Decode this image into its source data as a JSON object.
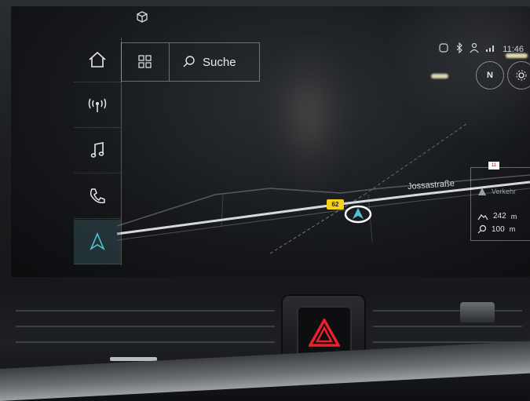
{
  "rail": {
    "items": [
      {
        "name": "home",
        "icon": "home-icon"
      },
      {
        "name": "radio",
        "icon": "radio-icon"
      },
      {
        "name": "media",
        "icon": "music-note-icon"
      },
      {
        "name": "phone",
        "icon": "phone-icon"
      },
      {
        "name": "navigation",
        "icon": "navigation-arrow-icon",
        "active": true
      }
    ]
  },
  "search": {
    "label": "Suche",
    "icon": "search-icon"
  },
  "menu_icon": "grid-icon",
  "status_bar": {
    "time": "11:46"
  },
  "compass_label": "N",
  "map": {
    "street_name": "Jossastraße",
    "speed_limit": "62"
  },
  "info_panel": {
    "badge": "11",
    "traffic_label": "Verkehr",
    "altitude": "242",
    "altitude_unit": "m",
    "scale": "100",
    "scale_unit": "m"
  },
  "colors": {
    "active_accent": "#4fc3d0",
    "speed_sign": "#f3d21b",
    "hazard": "#e8222a"
  }
}
